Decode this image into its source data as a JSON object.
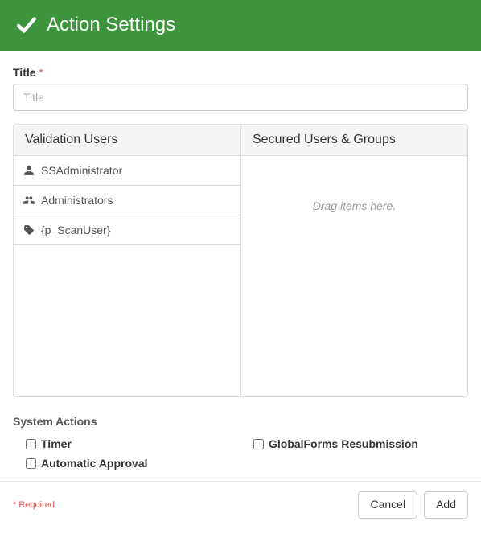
{
  "header": {
    "title": "Action Settings"
  },
  "title_field": {
    "label": "Title",
    "placeholder": "Title",
    "value": "",
    "required_marker": "*"
  },
  "lists": {
    "validation": {
      "header": "Validation Users",
      "items": [
        {
          "icon": "user-icon",
          "label": "SSAdministrator"
        },
        {
          "icon": "users-icon",
          "label": "Administrators"
        },
        {
          "icon": "tag-icon",
          "label": "{p_ScanUser}"
        }
      ]
    },
    "secured": {
      "header": "Secured Users & Groups",
      "placeholder": "Drag items here.",
      "items": []
    }
  },
  "system_actions": {
    "title": "System Actions",
    "items": [
      {
        "label": "Timer",
        "checked": false
      },
      {
        "label": "GlobalForms Resubmission",
        "checked": false
      },
      {
        "label": "Automatic Approval",
        "checked": false
      }
    ]
  },
  "footer": {
    "required_note": "* Required",
    "cancel": "Cancel",
    "add": "Add"
  }
}
